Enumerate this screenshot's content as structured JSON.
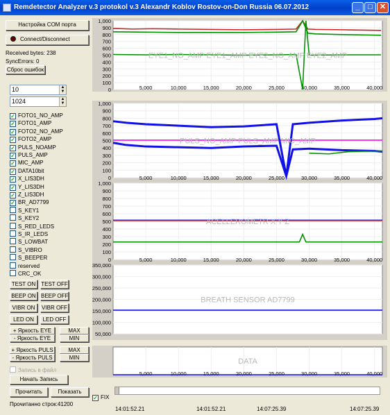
{
  "window": {
    "title": "Remdetector Analyzer v.3 protokol v.3 Alexandr Koblov Rostov-on-Don Russia 06.07.2012",
    "minimize": "_",
    "maximize": "□",
    "close": "✕"
  },
  "left": {
    "com_button": "Настройка COM порта",
    "connect_button": "Connect/Disconnect",
    "received_bytes": "Received bytes: 238",
    "sync_errors": "SyncErrors: 0",
    "reset_errors": "Сброс ошибок",
    "spin1": "10",
    "spin2": "1024",
    "checkboxes": [
      {
        "label": "FOTO1_NO_AMP",
        "checked": true
      },
      {
        "label": "FOTO1_AMP",
        "checked": true
      },
      {
        "label": "FOTO2_NO_AMP",
        "checked": true
      },
      {
        "label": "FOTO2_AMP",
        "checked": true
      },
      {
        "label": "PULS_NOAMP",
        "checked": true
      },
      {
        "label": "PULS_AMP",
        "checked": true
      },
      {
        "label": "MIC_AMP",
        "checked": true
      },
      {
        "label": "DATA10bit",
        "checked": true
      },
      {
        "label": "X_LIS3DH",
        "checked": true
      },
      {
        "label": "Y_LIS3DH",
        "checked": true
      },
      {
        "label": "Z_LIS3DH",
        "checked": true
      },
      {
        "label": "BR_AD7799",
        "checked": true
      },
      {
        "label": "S_KEY1",
        "checked": false
      },
      {
        "label": "S_KEY2",
        "checked": false
      },
      {
        "label": "S_RED_LEDS",
        "checked": false
      },
      {
        "label": "S_IR_LEDS",
        "checked": false
      },
      {
        "label": "S_LOWBAT",
        "checked": false
      },
      {
        "label": "S_VIBRO",
        "checked": false
      },
      {
        "label": "S_BEEPER",
        "checked": false
      },
      {
        "label": "reserved",
        "checked": false
      },
      {
        "label": "CRC_OK",
        "checked": false
      }
    ],
    "test_on": "TEST ON",
    "test_off": "TEST OFF",
    "beep_on": "BEEP ON",
    "beep_off": "BEEP OFF",
    "vibr_on": "VIBR ON",
    "vibr_off": "VIBR OFF",
    "led_on": "LED ON",
    "led_off": "LED OFF",
    "eye_plus": "+ Яркость EYE",
    "eye_minus": "- Яркость EYE",
    "max1": "MAX",
    "min1": "MIN",
    "puls_plus": "+ Яркость PULS",
    "puls_minus": "- Яркость PULS",
    "max2": "MAX",
    "min2": "MIN",
    "write_file": "Запись в файл",
    "start_record": "Начать Запись",
    "read": "Прочитать",
    "show": "Показать",
    "read_rows": "Прочитанно строк:41200"
  },
  "bottom": {
    "fix": "FIX",
    "times": [
      "14:01:52.21",
      "14:01:52.21",
      "14:07:25.39",
      "14:07:25.39"
    ]
  },
  "colors": {
    "red": "#d02020",
    "green": "#009000",
    "blue": "#1010e8",
    "magenta": "#ff00ff",
    "label": "#b8b8b8"
  },
  "chart_data": [
    {
      "type": "line",
      "title": "EYE1_NO_AMP EYE1_AMP EYE2_NO_AMP EYE2_AMP",
      "x_ticks": [
        "5,000",
        "10,000",
        "15,000",
        "20,000",
        "25,000",
        "30,000",
        "35,000",
        "40,000"
      ],
      "y_ticks": [
        "1,000",
        "900",
        "800",
        "700",
        "600",
        "500",
        "400",
        "300",
        "200",
        "100",
        "0"
      ],
      "ylim": [
        0,
        1000
      ],
      "xlim": [
        0,
        41200
      ],
      "series": [
        {
          "color": "red",
          "x": [
            0,
            3000,
            6000,
            10000,
            15000,
            20000,
            25000,
            28000,
            29000,
            29800,
            31000,
            35000,
            41000
          ],
          "y": [
            890,
            880,
            885,
            880,
            875,
            870,
            875,
            880,
            1000,
            880,
            875,
            870,
            860
          ]
        },
        {
          "color": "green",
          "x": [
            0,
            5000,
            10000,
            15000,
            20000,
            25000,
            28000,
            29000,
            29800,
            31000,
            35000,
            41000
          ],
          "y": [
            840,
            835,
            830,
            830,
            830,
            835,
            840,
            1000,
            820,
            810,
            800,
            790
          ]
        },
        {
          "color": "green",
          "x": [
            0,
            5000,
            10000,
            15000,
            20000,
            25000,
            28000,
            29000,
            29500,
            30000,
            35000,
            41000
          ],
          "y": [
            510,
            505,
            510,
            505,
            500,
            505,
            510,
            0,
            1000,
            500,
            505,
            505
          ]
        }
      ]
    },
    {
      "type": "line",
      "title": "PULS_NO_AMP PULS_AMP MIC_AMP",
      "x_ticks": [
        "5,000",
        "10,000",
        "15,000",
        "20,000",
        "25,000",
        "30,000",
        "35,000",
        "40,000"
      ],
      "y_ticks": [
        "1,000",
        "900",
        "800",
        "700",
        "600",
        "500",
        "400",
        "300",
        "200",
        "100",
        "0"
      ],
      "ylim": [
        0,
        1000
      ],
      "xlim": [
        0,
        41200
      ],
      "series": [
        {
          "color": "magenta",
          "x": [
            0,
            41200
          ],
          "y": [
            505,
            505
          ]
        },
        {
          "color": "blue",
          "x": [
            0,
            2000,
            5000,
            10000,
            15000,
            20000,
            25000,
            26500,
            27500,
            30000,
            35000,
            40000,
            41200
          ],
          "y": [
            760,
            740,
            720,
            700,
            680,
            690,
            720,
            20,
            720,
            740,
            770,
            790,
            800
          ]
        },
        {
          "color": "blue",
          "x": [
            0,
            2000,
            5000,
            10000,
            15000,
            20000,
            25000,
            26500,
            27500,
            30000,
            35000,
            40000,
            41200
          ],
          "y": [
            470,
            440,
            420,
            410,
            400,
            420,
            430,
            20,
            380,
            390,
            370,
            360,
            350
          ]
        },
        {
          "color": "green",
          "x": [
            30000,
            33000,
            36000,
            41200
          ],
          "y": [
            330,
            320,
            350,
            360
          ]
        }
      ]
    },
    {
      "type": "line",
      "title": "ACELLEROMETR X Y Z",
      "x_ticks": [
        "5,000",
        "10,000",
        "15,000",
        "20,000",
        "25,000",
        "30,000",
        "35,000",
        "40,000"
      ],
      "y_ticks": [
        "1,000",
        "900",
        "800",
        "700",
        "600",
        "500",
        "400",
        "300",
        "200",
        "100",
        "0"
      ],
      "ylim": [
        0,
        1000
      ],
      "xlim": [
        0,
        41200
      ],
      "series": [
        {
          "color": "blue",
          "x": [
            0,
            41200
          ],
          "y": [
            515,
            515
          ]
        },
        {
          "color": "red",
          "x": [
            0,
            41200
          ],
          "y": [
            510,
            510
          ]
        },
        {
          "color": "green",
          "x": [
            0,
            28500,
            29000,
            29500,
            41200
          ],
          "y": [
            230,
            230,
            330,
            230,
            230
          ]
        }
      ]
    },
    {
      "type": "line",
      "title": "BREATH SENSOR AD7799",
      "y_ticks": [
        "350,000",
        "300,000",
        "250,000",
        "200,000",
        "150,000",
        "100,000",
        "50,000"
      ],
      "ylim": [
        40000,
        360000
      ],
      "xlim": [
        0,
        41200
      ],
      "series": [
        {
          "color": "blue",
          "x": [
            0,
            41200
          ],
          "y": [
            150000,
            150000
          ]
        }
      ]
    },
    {
      "type": "line",
      "title": "DATA",
      "x_ticks": [
        "5,000",
        "10,000",
        "15,000",
        "20,000",
        "25,000",
        "30,000",
        "35,000",
        "40,000"
      ],
      "xlim": [
        0,
        41200
      ],
      "series": [
        {
          "color": "blue",
          "x": [
            0,
            41200
          ],
          "y": [
            0,
            0
          ]
        }
      ]
    }
  ]
}
